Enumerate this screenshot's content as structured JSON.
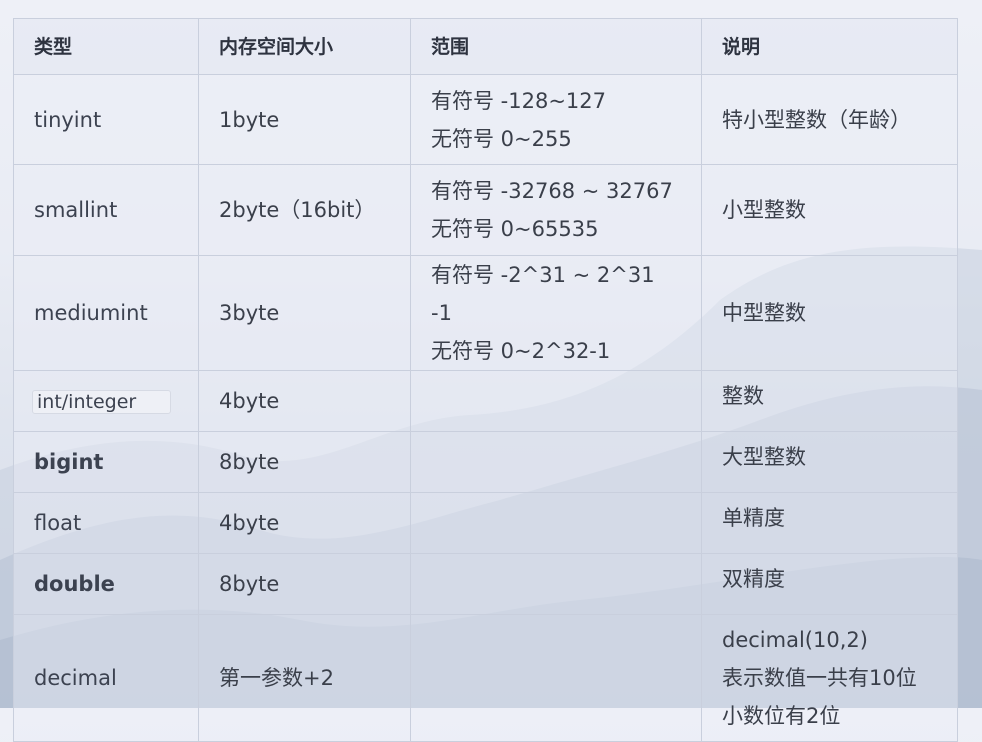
{
  "table": {
    "headers": [
      "类型",
      "内存空间大小",
      "范围",
      "说明"
    ],
    "rows": [
      {
        "type": "tinyint",
        "size": "1byte",
        "range": [
          "有符号 -128~127",
          "无符号 0~255"
        ],
        "desc": [
          "特小型整数（年龄）"
        ]
      },
      {
        "type": "smallint",
        "size": "2byte（16bit）",
        "range": [
          "有符号 -32768 ~ 32767",
          "无符号 0~65535"
        ],
        "desc": [
          "小型整数"
        ]
      },
      {
        "type": "mediumint",
        "size": "3byte",
        "range": [
          "有符号 -2^31 ~ 2^31 -1",
          "无符号 0~2^32-1"
        ],
        "desc": [
          "中型整数"
        ]
      },
      {
        "type": "int/integer",
        "size": "4byte",
        "range": [],
        "desc": [
          "整数"
        ]
      },
      {
        "type": "bigint",
        "size": "8byte",
        "range": [],
        "desc": [
          "大型整数"
        ]
      },
      {
        "type": "float",
        "size": "4byte",
        "range": [],
        "desc": [
          "单精度"
        ]
      },
      {
        "type": "double",
        "size": "8byte",
        "range": [],
        "desc": [
          "双精度"
        ]
      },
      {
        "type": "decimal",
        "size": "第一参数+2",
        "range": [],
        "desc": [
          "decimal(10,2)",
          "表示数值一共有10位",
          "小数位有2位"
        ]
      }
    ]
  }
}
